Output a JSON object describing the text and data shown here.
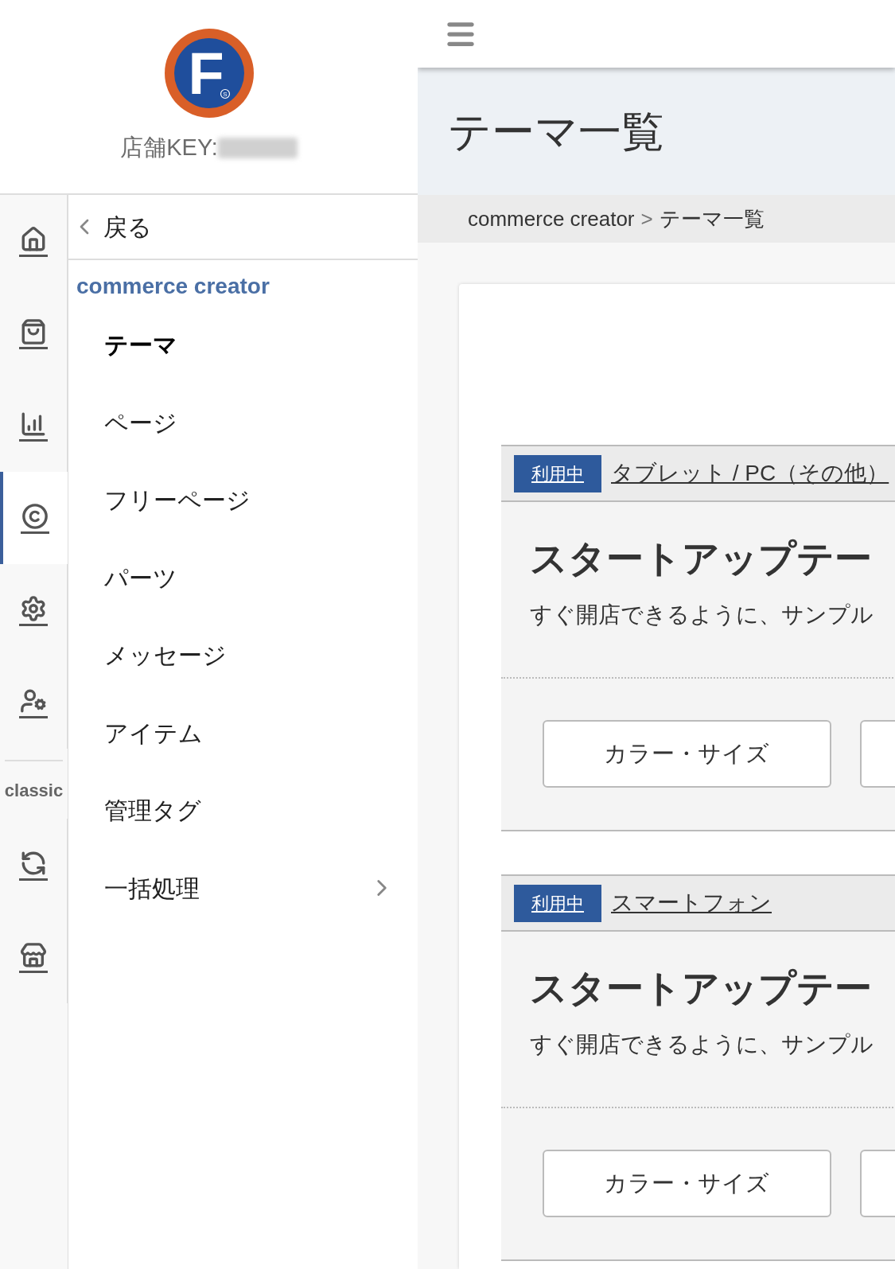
{
  "logo": {
    "letter": "F",
    "mark": "S"
  },
  "store_key": {
    "label": "店舗KEY:"
  },
  "rail": {
    "items": [
      {
        "selected": false
      },
      {
        "selected": false
      },
      {
        "selected": false
      },
      {
        "selected": true
      },
      {
        "selected": false
      },
      {
        "selected": false
      }
    ],
    "section_label": "classic",
    "classic_items": [
      {
        "selected": false
      },
      {
        "selected": false
      }
    ]
  },
  "menu": {
    "back": "戻る",
    "section": "commerce creator",
    "items": [
      {
        "label": "テーマ",
        "selected": true,
        "has_submenu": false
      },
      {
        "label": "ページ",
        "selected": false,
        "has_submenu": false
      },
      {
        "label": "フリーページ",
        "selected": false,
        "has_submenu": false
      },
      {
        "label": "パーツ",
        "selected": false,
        "has_submenu": false
      },
      {
        "label": "メッセージ",
        "selected": false,
        "has_submenu": false
      },
      {
        "label": "アイテム",
        "selected": false,
        "has_submenu": false
      },
      {
        "label": "管理タグ",
        "selected": false,
        "has_submenu": false
      },
      {
        "label": "一括処理",
        "selected": false,
        "has_submenu": true
      }
    ]
  },
  "page": {
    "title": "テーマ一覧",
    "breadcrumb": [
      "commerce creator",
      "テーマ一覧"
    ],
    "breadcrumb_separator": ">"
  },
  "themes": [
    {
      "badge": "利用中",
      "device": "タブレット / PC（その他）",
      "title": "スタートアップテー",
      "description": "すぐ開店できるように、サンプル",
      "buttons": [
        "カラー・サイズ"
      ]
    },
    {
      "badge": "利用中",
      "device": "スマートフォン",
      "title": "スタートアップテー",
      "description": "すぐ開店できるように、サンプル",
      "buttons": [
        "カラー・サイズ"
      ]
    }
  ]
}
